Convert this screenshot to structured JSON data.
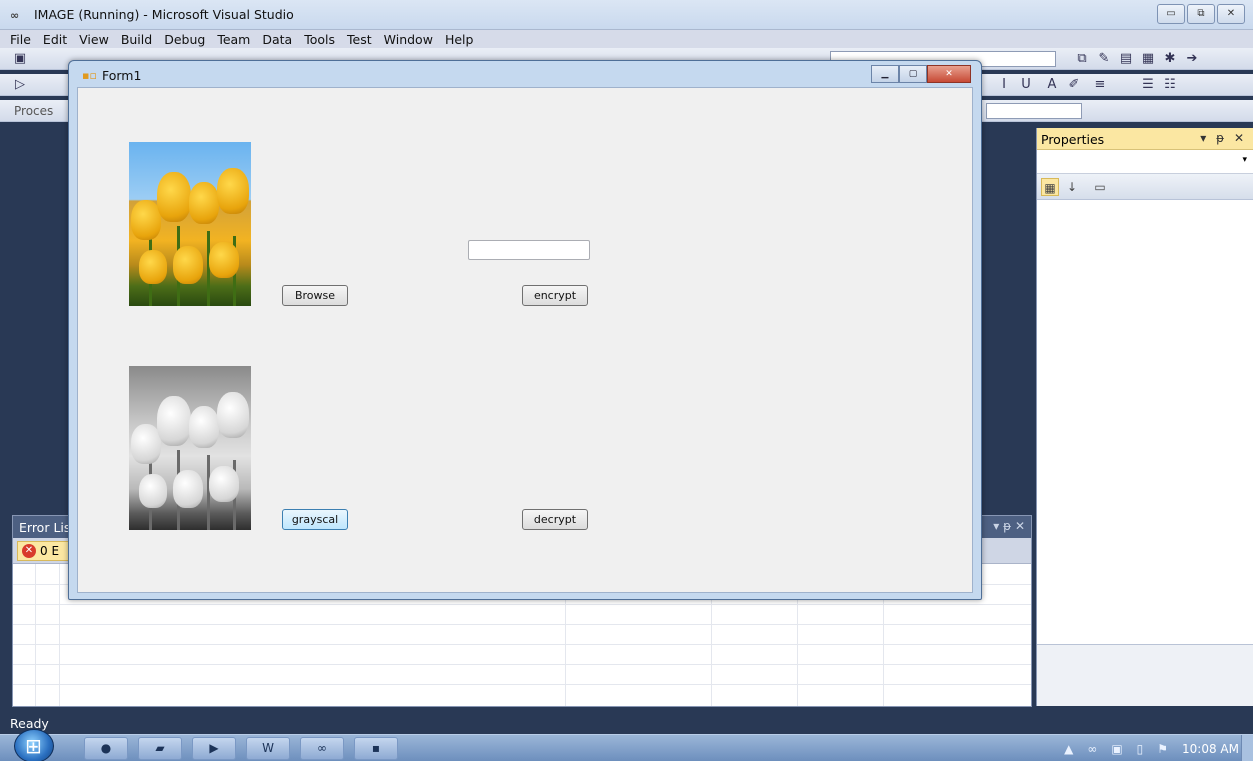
{
  "vs": {
    "title": "IMAGE (Running) - Microsoft Visual Studio",
    "logo": "∞",
    "window_buttons": [
      "▭",
      "⧉",
      "✕"
    ],
    "menu": [
      "File",
      "Edit",
      "View",
      "Build",
      "Debug",
      "Team",
      "Data",
      "Tools",
      "Test",
      "Window",
      "Help"
    ],
    "toolbar3_label": "Proces",
    "status": "Ready"
  },
  "error_list": {
    "title": "Error Lis",
    "pin_controls": "▾ ᵽ ✕",
    "errors_badge": "0 E",
    "error_icon": "✕"
  },
  "properties": {
    "title": "Properties",
    "controls": "▾ ᵽ ✕",
    "combo_arrow": "▾",
    "tool_icons": [
      "categorized-icon",
      "alphabetical-icon",
      "property-pages-icon"
    ]
  },
  "form1": {
    "title": "Form1",
    "icon": "form-icon",
    "buttons": {
      "browse": "Browse",
      "encrypt": "encrypt",
      "grayscal": "grayscal",
      "decrypt": "decrypt"
    },
    "textbox_value": "",
    "images": [
      "color-tulips",
      "grayscale-tulips"
    ]
  },
  "taskbar": {
    "items": [
      "chrome-icon",
      "explorer-icon",
      "media-player-icon",
      "word-icon",
      "visual-studio-icon",
      "form-app-icon"
    ],
    "time": "10:08 AM"
  },
  "colors": {
    "vs_background": "#293955",
    "properties_header": "#fbe7a2",
    "form_client": "#f0f0f0"
  }
}
